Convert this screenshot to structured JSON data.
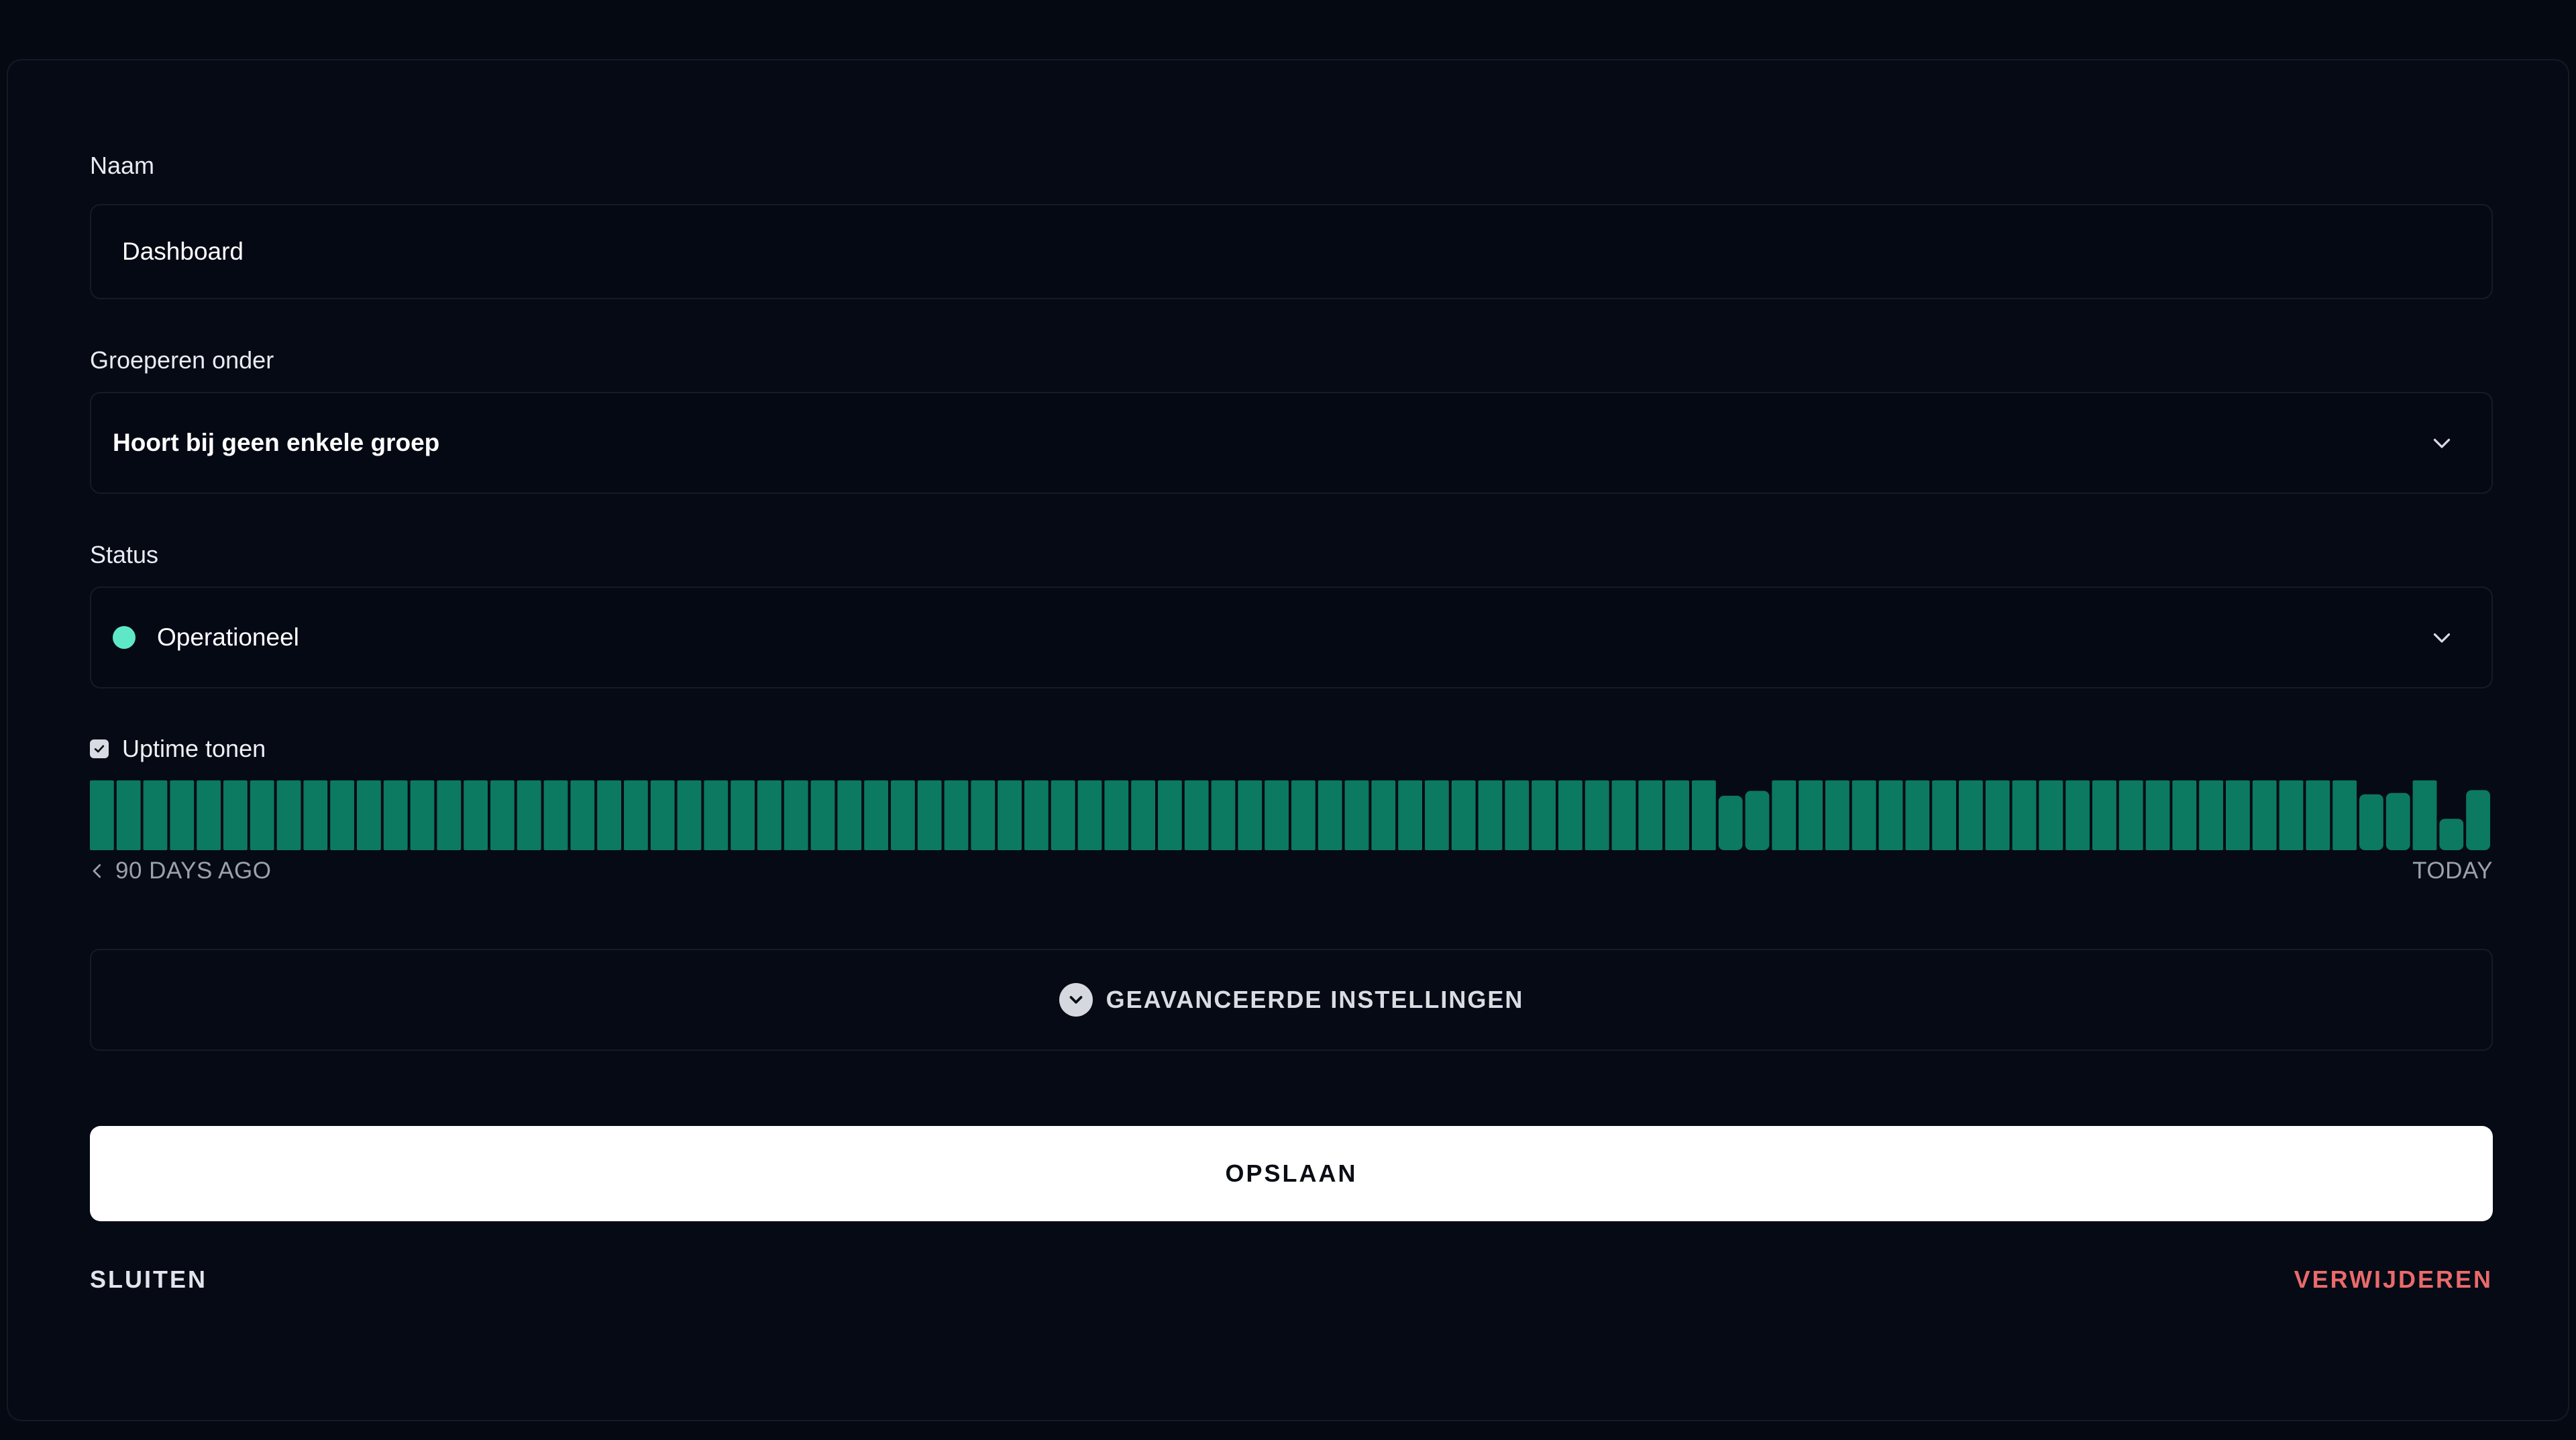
{
  "form": {
    "name_label": "Naam",
    "name_value": "Dashboard",
    "group_label": "Groeperen onder",
    "group_value": "Hoort bij geen enkele groep",
    "status_label": "Status",
    "status_value": "Operationeel",
    "status_color": "#5ee8c8"
  },
  "uptime": {
    "checkbox_label": "Uptime tonen",
    "checked": true,
    "start_label": "90 DAYS AGO",
    "end_label": "TODAY",
    "bar_color": "#0b7a60",
    "days": 90,
    "degraded_days": [
      {
        "day": 62,
        "level": 0.78
      },
      {
        "day": 63,
        "level": 0.85
      },
      {
        "day": 86,
        "level": 0.8
      },
      {
        "day": 87,
        "level": 0.82
      },
      {
        "day": 89,
        "level": 0.45
      },
      {
        "day": 90,
        "level": 0.86
      }
    ]
  },
  "advanced": {
    "label": "GEAVANCEERDE INSTELLINGEN",
    "icon": "chevron-down-circle-icon"
  },
  "actions": {
    "save_label": "OPSLAAN",
    "close_label": "SLUITEN",
    "delete_label": "VERWIJDEREN",
    "delete_color": "#ea6a6a"
  }
}
